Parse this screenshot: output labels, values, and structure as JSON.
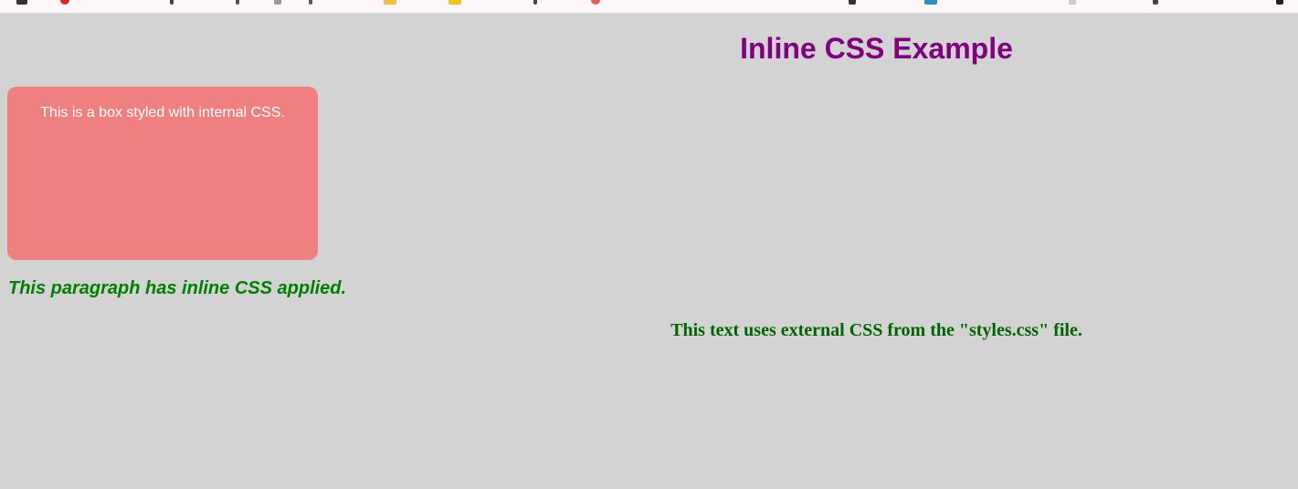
{
  "bookmarks_bar": {
    "icons": [
      "apps-icon",
      "pinterest-icon",
      "bookmark-icon",
      "bookmark-icon",
      "bookmark-icon",
      "bookmark-icon",
      "folder-icon",
      "folder-icon",
      "bookmark-icon",
      "bookmark-icon",
      "bookmark-icon",
      "bookmark-icon",
      "bookmark-icon",
      "bookmark-icon",
      "bookmark-icon"
    ]
  },
  "page": {
    "heading": "Inline CSS Example",
    "box_text": "This is a box styled with internal CSS.",
    "inline_paragraph": "This paragraph has inline CSS applied.",
    "external_text": "This text uses external CSS from the \"styles.css\" file."
  },
  "colors": {
    "background": "#d3d3d3",
    "heading": "#800080",
    "box_background": "#f08080",
    "box_text": "#ffffff",
    "inline_paragraph": "#008000",
    "external_text": "#006400"
  }
}
